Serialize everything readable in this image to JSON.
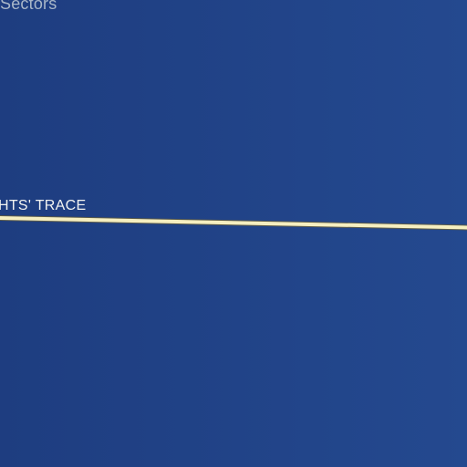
{
  "map": {
    "colors": {
      "water_left": "#1e3d80",
      "water_right": "#24498f",
      "road_fill": "#f6efc0",
      "road_casing": "#5a5a4a"
    },
    "labels": {
      "area": "Sectors",
      "road": "HTS' TRACE"
    }
  }
}
